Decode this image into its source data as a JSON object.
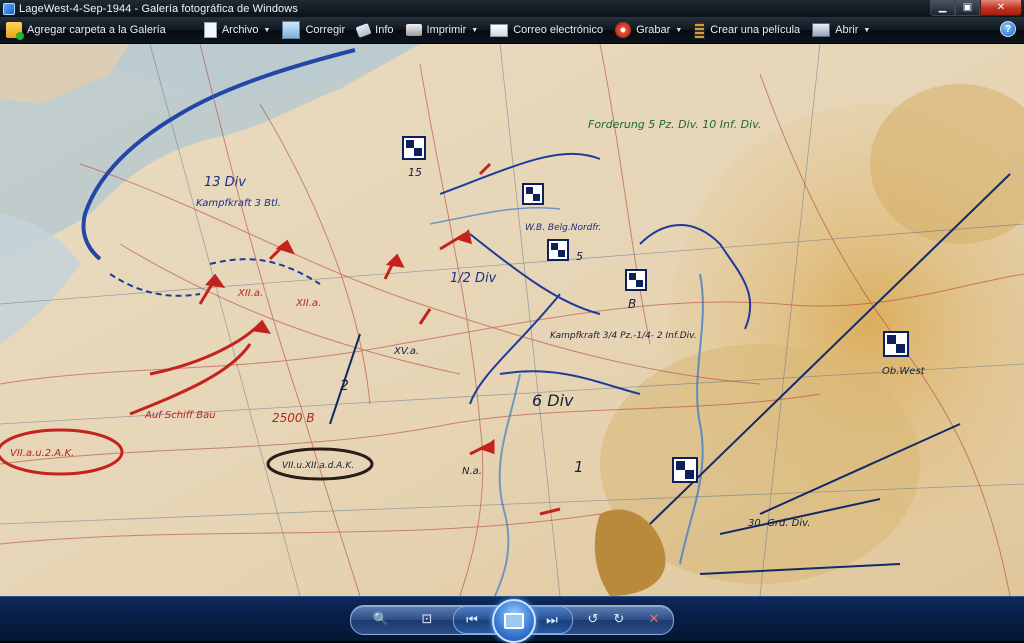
{
  "window": {
    "title": "LageWest-4-Sep-1944 - Galería fotográfica de Windows",
    "controls": {
      "minimize": "▁",
      "maximize": "▣",
      "close": "✕"
    }
  },
  "toolbar": {
    "items": [
      {
        "label": "Agregar carpeta a la Galería",
        "icon": "gallery-add-icon",
        "dropdown": false
      },
      {
        "label": "Archivo",
        "icon": "file-icon",
        "dropdown": true
      },
      {
        "label": "Corregir",
        "icon": "fix-icon",
        "dropdown": false
      },
      {
        "label": "Info",
        "icon": "info-tag-icon",
        "dropdown": false
      },
      {
        "label": "Imprimir",
        "icon": "printer-icon",
        "dropdown": true
      },
      {
        "label": "Correo electrónico",
        "icon": "email-icon",
        "dropdown": false
      },
      {
        "label": "Grabar",
        "icon": "burn-disc-icon",
        "dropdown": true
      },
      {
        "label": "Crear una película",
        "icon": "film-icon",
        "dropdown": false
      },
      {
        "label": "Abrir",
        "icon": "open-icon",
        "dropdown": true
      }
    ],
    "help": "?"
  },
  "map_annotations": {
    "unit_labels": [
      "13 Div",
      "Kampfkraft 3 Btl.",
      "XII.a.",
      "XII.a.",
      "Kampfkraft 3/4 Pz.-1/4- 2 Inf.Div.",
      "XV.a.",
      "6 Div",
      "1/2 Div",
      "W.B. Belg.Nordfr.",
      "Forderung 5 Pz. Div. 10 Inf. Div.",
      "Ob.West",
      "30. Grd. Div.",
      "2",
      "1",
      "B",
      "15",
      "5",
      "N.a.",
      "Auf Schiff Bau",
      "2500 B"
    ],
    "ellipse_labels": [
      "VII.a.u.2.A.K.",
      "VII.u.XII.a.d.A.K."
    ]
  },
  "bottom_controls": {
    "zoom": "🔍",
    "fit": "⊡",
    "previous": "⏮",
    "slideshow": "▭",
    "next": "⏭",
    "rotate_left": "↺",
    "rotate_right": "↻",
    "delete": "✕"
  }
}
